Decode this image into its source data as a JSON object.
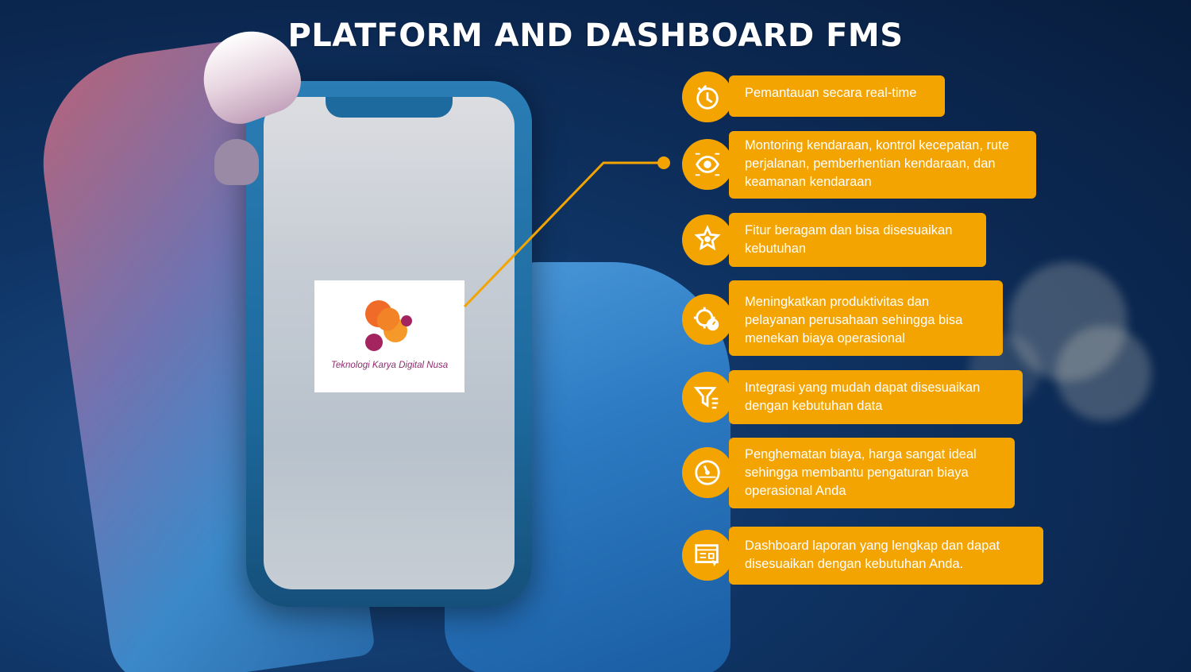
{
  "title": "PLATFORM AND DASHBOARD FMS",
  "logo": {
    "text": "Teknologi Karya Digital Nusa"
  },
  "colors": {
    "accent": "#f4a400",
    "background": "#0b2750",
    "text": "#ffffff",
    "logo_purple": "#8e2d6e",
    "logo_orange": "#f06a28"
  },
  "features": [
    {
      "icon": "clock-check-icon",
      "text": "Pemantauan secara real-time"
    },
    {
      "icon": "eye-chip-icon",
      "text": "Montoring kendaraan, kontrol kecepatan, rute perjalanan, pemberhentian kendaraan, dan keamanan kendaraan"
    },
    {
      "icon": "star-badge-icon",
      "text": "Fitur beragam dan bisa disesuaikan kebutuhan"
    },
    {
      "icon": "gear-gauge-icon",
      "text": "Meningkatkan produktivitas dan pelayanan perusahaan sehingga bisa menekan biaya operasional"
    },
    {
      "icon": "funnel-integration-icon",
      "text": "Integrasi yang mudah dapat disesuaikan dengan kebutuhan data"
    },
    {
      "icon": "speedometer-icon",
      "text": "Penghematan biaya, harga sangat ideal sehingga membantu pengaturan biaya operasional Anda"
    },
    {
      "icon": "dashboard-report-icon",
      "text": "Dashboard laporan yang lengkap dan dapat disesuaikan dengan kebutuhan Anda."
    }
  ]
}
